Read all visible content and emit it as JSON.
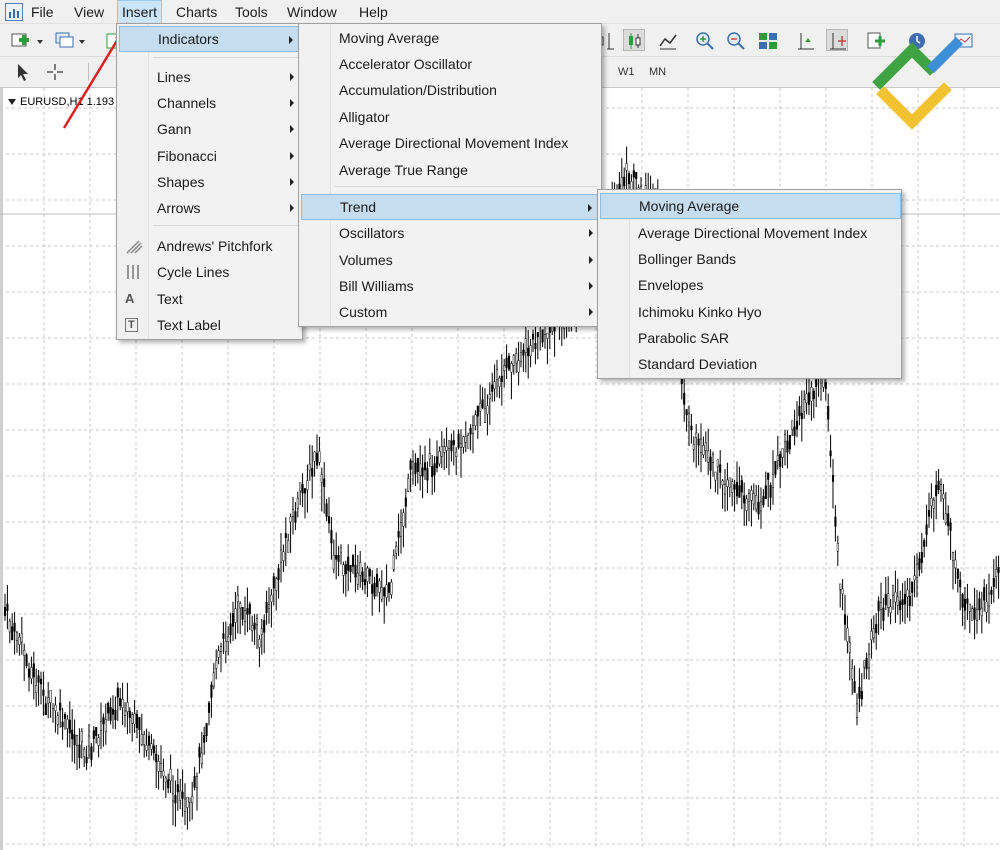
{
  "menubar": {
    "items": [
      "File",
      "View",
      "Insert",
      "Charts",
      "Tools",
      "Window",
      "Help"
    ]
  },
  "toolbar": {
    "timeframes": [
      "W1",
      "MN"
    ]
  },
  "chart": {
    "title": "EURUSD,H1  1.193"
  },
  "insert_menu": {
    "items": [
      {
        "label": "Indicators",
        "submenu": true
      },
      {
        "label": "Lines",
        "submenu": true
      },
      {
        "label": "Channels",
        "submenu": true
      },
      {
        "label": "Gann",
        "submenu": true
      },
      {
        "label": "Fibonacci",
        "submenu": true
      },
      {
        "label": "Shapes",
        "submenu": true
      },
      {
        "label": "Arrows",
        "submenu": true
      },
      {
        "label": "Andrews' Pitchfork",
        "icon": "pitchfork-icon"
      },
      {
        "label": "Cycle Lines",
        "icon": "cycle-lines-icon"
      },
      {
        "label": "Text",
        "icon": "text-icon",
        "glyph": "A"
      },
      {
        "label": "Text Label",
        "icon": "text-label-icon",
        "glyph": "T"
      }
    ]
  },
  "indicators_menu": {
    "items": [
      {
        "label": "Moving Average"
      },
      {
        "label": "Accelerator Oscillator"
      },
      {
        "label": "Accumulation/Distribution"
      },
      {
        "label": "Alligator"
      },
      {
        "label": "Average Directional Movement Index"
      },
      {
        "label": "Average True Range"
      },
      {
        "label": "Trend",
        "submenu": true
      },
      {
        "label": "Oscillators",
        "submenu": true
      },
      {
        "label": "Volumes",
        "submenu": true
      },
      {
        "label": "Bill Williams",
        "submenu": true
      },
      {
        "label": "Custom",
        "submenu": true
      }
    ]
  },
  "trend_menu": {
    "items": [
      {
        "label": "Moving Average"
      },
      {
        "label": "Average Directional Movement Index"
      },
      {
        "label": "Bollinger Bands"
      },
      {
        "label": "Envelopes"
      },
      {
        "label": "Ichimoku Kinko Hyo"
      },
      {
        "label": "Parabolic SAR"
      },
      {
        "label": "Standard Deviation"
      }
    ]
  },
  "colors": {
    "highlight": "#c6ddef",
    "menu_bg": "#f2f2f2",
    "annotation_arrow": "#e02020",
    "logo_green": "#3fa243",
    "logo_yellow": "#f2c230",
    "logo_blue": "#3d8fd6"
  }
}
